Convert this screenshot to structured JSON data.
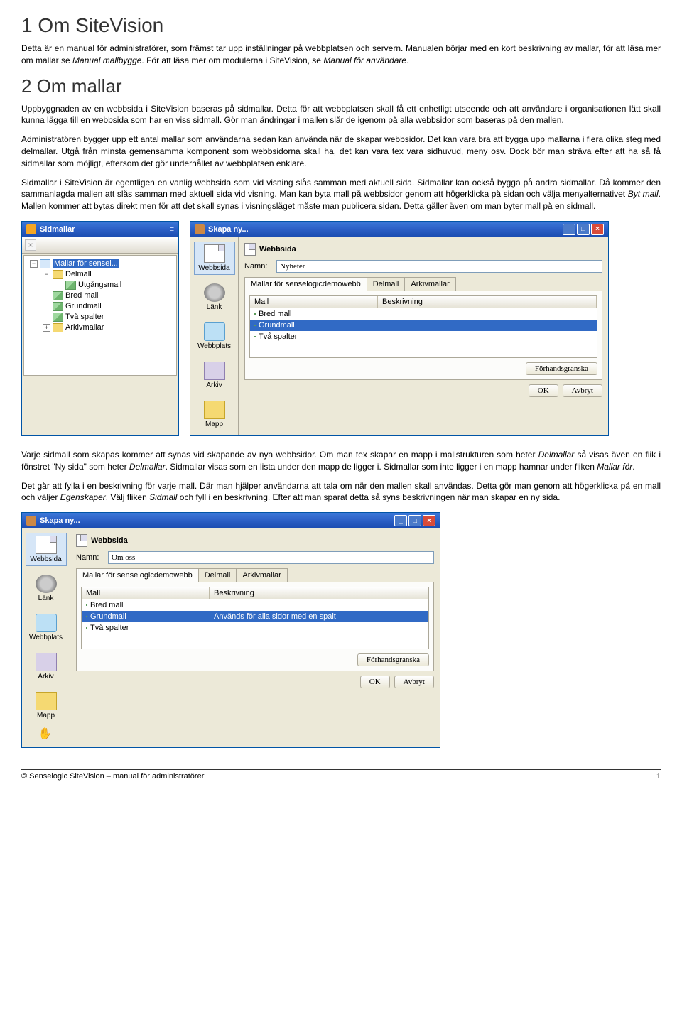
{
  "headings": {
    "h1": "1 Om SiteVision",
    "h2": "2 Om mallar"
  },
  "paras": {
    "p1a": "Detta är en manual för administratörer, som främst tar upp inställningar på webbplatsen och servern. Manualen börjar med en kort beskrivning av mallar, för att läsa mer om mallar se ",
    "p1b": "Manual mallbygge",
    "p1c": ". För att läsa mer om modulerna i SiteVision, se ",
    "p1d": "Manual för användare",
    "p1e": ".",
    "p2": "Uppbyggnaden av en webbsida i SiteVision baseras på sidmallar. Detta för att webbplatsen skall få ett enhetligt utseende och att användare i organisationen lätt skall kunna lägga till en webbsida som har en viss sidmall. Gör man ändringar i mallen slår de igenom på alla webbsidor som baseras på den mallen.",
    "p3": "Administratören bygger upp ett antal mallar som användarna sedan kan använda när de skapar webbsidor. Det kan vara bra att bygga upp mallarna i flera olika steg med delmallar. Utgå från minsta gemensamma komponent som webbsidorna skall ha, det kan vara tex vara sidhuvud, meny osv.  Dock bör man sträva efter att ha så få sidmallar som möjligt, eftersom det gör underhållet av webbplatsen enklare.",
    "p4a": "Sidmallar i SiteVision är egentligen en vanlig webbsida som vid visning slås samman med aktuell sida. Sidmallar kan också bygga på andra sidmallar. Då kommer den sammanlagda mallen att slås samman med aktuell sida vid visning. Man kan byta mall på webbsidor genom att högerklicka på sidan och välja menyalternativet ",
    "p4b": "Byt mall",
    "p4c": ". Mallen kommer att bytas direkt men för att det skall synas i visningsläget måste man publicera sidan. Detta gäller även om man byter mall på en sidmall.",
    "p5a": "Varje sidmall som skapas kommer att synas vid skapande av nya webbsidor.  Om man tex skapar en mapp i mallstrukturen som heter ",
    "p5b": "Delmallar",
    "p5c": " så visas även en flik i fönstret \"Ny sida\" som heter ",
    "p5d": "Delmallar",
    "p5e": ". Sidmallar visas som en lista under den mapp de ligger i.  Sidmallar som inte ligger  i en mapp hamnar under  fliken ",
    "p5f": "Mallar för",
    "p5g": ".",
    "p6a": "Det går att fylla i en beskrivning för varje mall. Där man hjälper användarna att tala om när den mallen skall användas. Detta gör man genom att högerklicka på en mall och väljer ",
    "p6b": "Egenskaper",
    "p6c": ". Välj fliken ",
    "p6d": "Sidmall",
    "p6e": " och fyll i en beskrivning.  Efter att man sparat detta så syns beskrivningen när man skapar en ny sida."
  },
  "sidepanel": {
    "title": "Sidmallar",
    "items": {
      "root": "Mallar för sensel...",
      "delmall": "Delmall",
      "utgangsmall": "Utgångsmall",
      "bredmall": "Bred mall",
      "grundmall": "Grundmall",
      "tvaspalter": "Två spalter",
      "arkivmallar": "Arkivmallar"
    }
  },
  "create1": {
    "title": "Skapa ny...",
    "left": {
      "webbsida": "Webbsida",
      "lank": "Länk",
      "webbplats": "Webbplats",
      "arkiv": "Arkiv",
      "mapp": "Mapp"
    },
    "header": "Webbsida",
    "name_label": "Namn:",
    "name_value": "Nyheter",
    "tabs": {
      "t1": "Mallar för senselogicdemowebb",
      "t2": "Delmall",
      "t3": "Arkivmallar"
    },
    "th1": "Mall",
    "th2": "Beskrivning",
    "rows": {
      "r1": "Bred mall",
      "r2": "Grundmall",
      "r3": "Två spalter"
    },
    "preview_btn": "Förhandsgranska",
    "ok": "OK",
    "cancel": "Avbryt"
  },
  "create2": {
    "title": "Skapa ny...",
    "header": "Webbsida",
    "name_label": "Namn:",
    "name_value": "Om oss",
    "tabs": {
      "t1": "Mallar för senselogicdemowebb",
      "t2": "Delmall",
      "t3": "Arkivmallar"
    },
    "th1": "Mall",
    "th2": "Beskrivning",
    "rows": {
      "r1": "Bred mall",
      "r2": "Grundmall",
      "r2_desc": "Används för alla sidor med en spalt",
      "r3": "Två spalter"
    },
    "preview_btn": "Förhandsgranska",
    "ok": "OK",
    "cancel": "Avbryt"
  },
  "footer": {
    "left": "© Senselogic SiteVision – manual för administratörer",
    "right": "1"
  }
}
